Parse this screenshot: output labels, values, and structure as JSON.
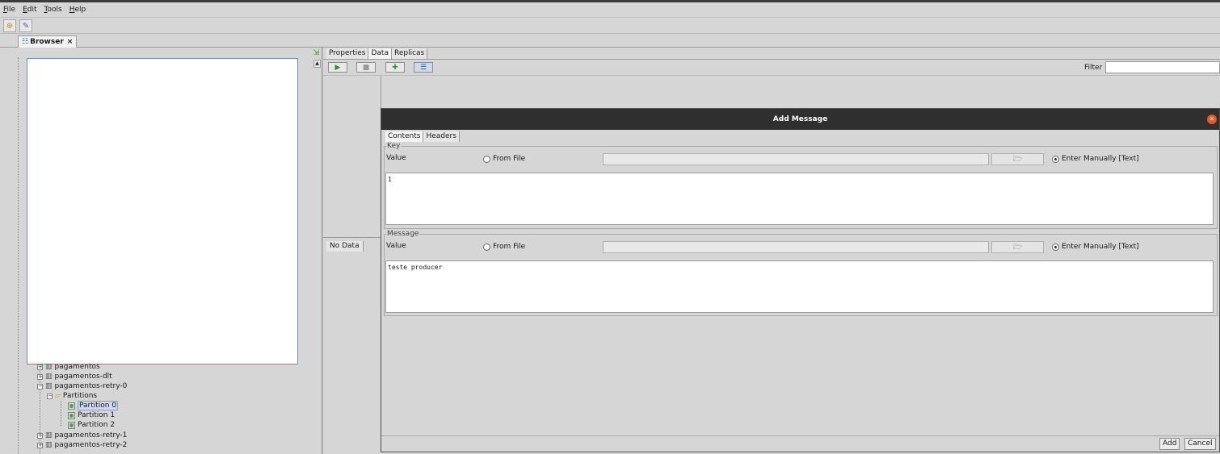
{
  "menu": [
    "File",
    "Edit",
    "Tools",
    "Help"
  ],
  "browser_tab": {
    "label": "Browser",
    "close": "×"
  },
  "tree": {
    "items": [
      {
        "label": "pagamentos",
        "kind": "topic",
        "expander": "+"
      },
      {
        "label": "pagamentos-dlt",
        "kind": "topic",
        "expander": "+"
      },
      {
        "label": "pagamentos-retry-0",
        "kind": "topic",
        "expander": "−"
      },
      {
        "label": "Partitions",
        "kind": "folder",
        "expander": "−"
      },
      {
        "label": "Partition 0",
        "kind": "partition",
        "selected": true
      },
      {
        "label": "Partition 1",
        "kind": "partition"
      },
      {
        "label": "Partition 2",
        "kind": "partition"
      },
      {
        "label": "pagamentos-retry-1",
        "kind": "topic",
        "expander": "+"
      },
      {
        "label": "pagamentos-retry-2",
        "kind": "topic",
        "expander": "+"
      }
    ]
  },
  "right_tabs": [
    "Properties",
    "Data",
    "Replicas"
  ],
  "right_active_tab": "Data",
  "filter": {
    "label": "Filter",
    "value": ""
  },
  "nodata_tab": "No Data",
  "dialog": {
    "title": "Add Message",
    "tabs": [
      "Contents",
      "Headers"
    ],
    "key": {
      "legend": "Key",
      "value_label": "Value",
      "from_file": "From File",
      "enter_manually": "Enter Manually [Text]",
      "text": "1"
    },
    "message": {
      "legend": "Message",
      "value_label": "Value",
      "from_file": "From File",
      "enter_manually": "Enter Manually [Text]",
      "text": "teste producer"
    },
    "add_button": "Add",
    "cancel_button": "Cancel"
  },
  "colors": {
    "accent_close": "#e85a1e",
    "titlebar": "#2f2f2f",
    "selection": "#cfd9ea"
  }
}
